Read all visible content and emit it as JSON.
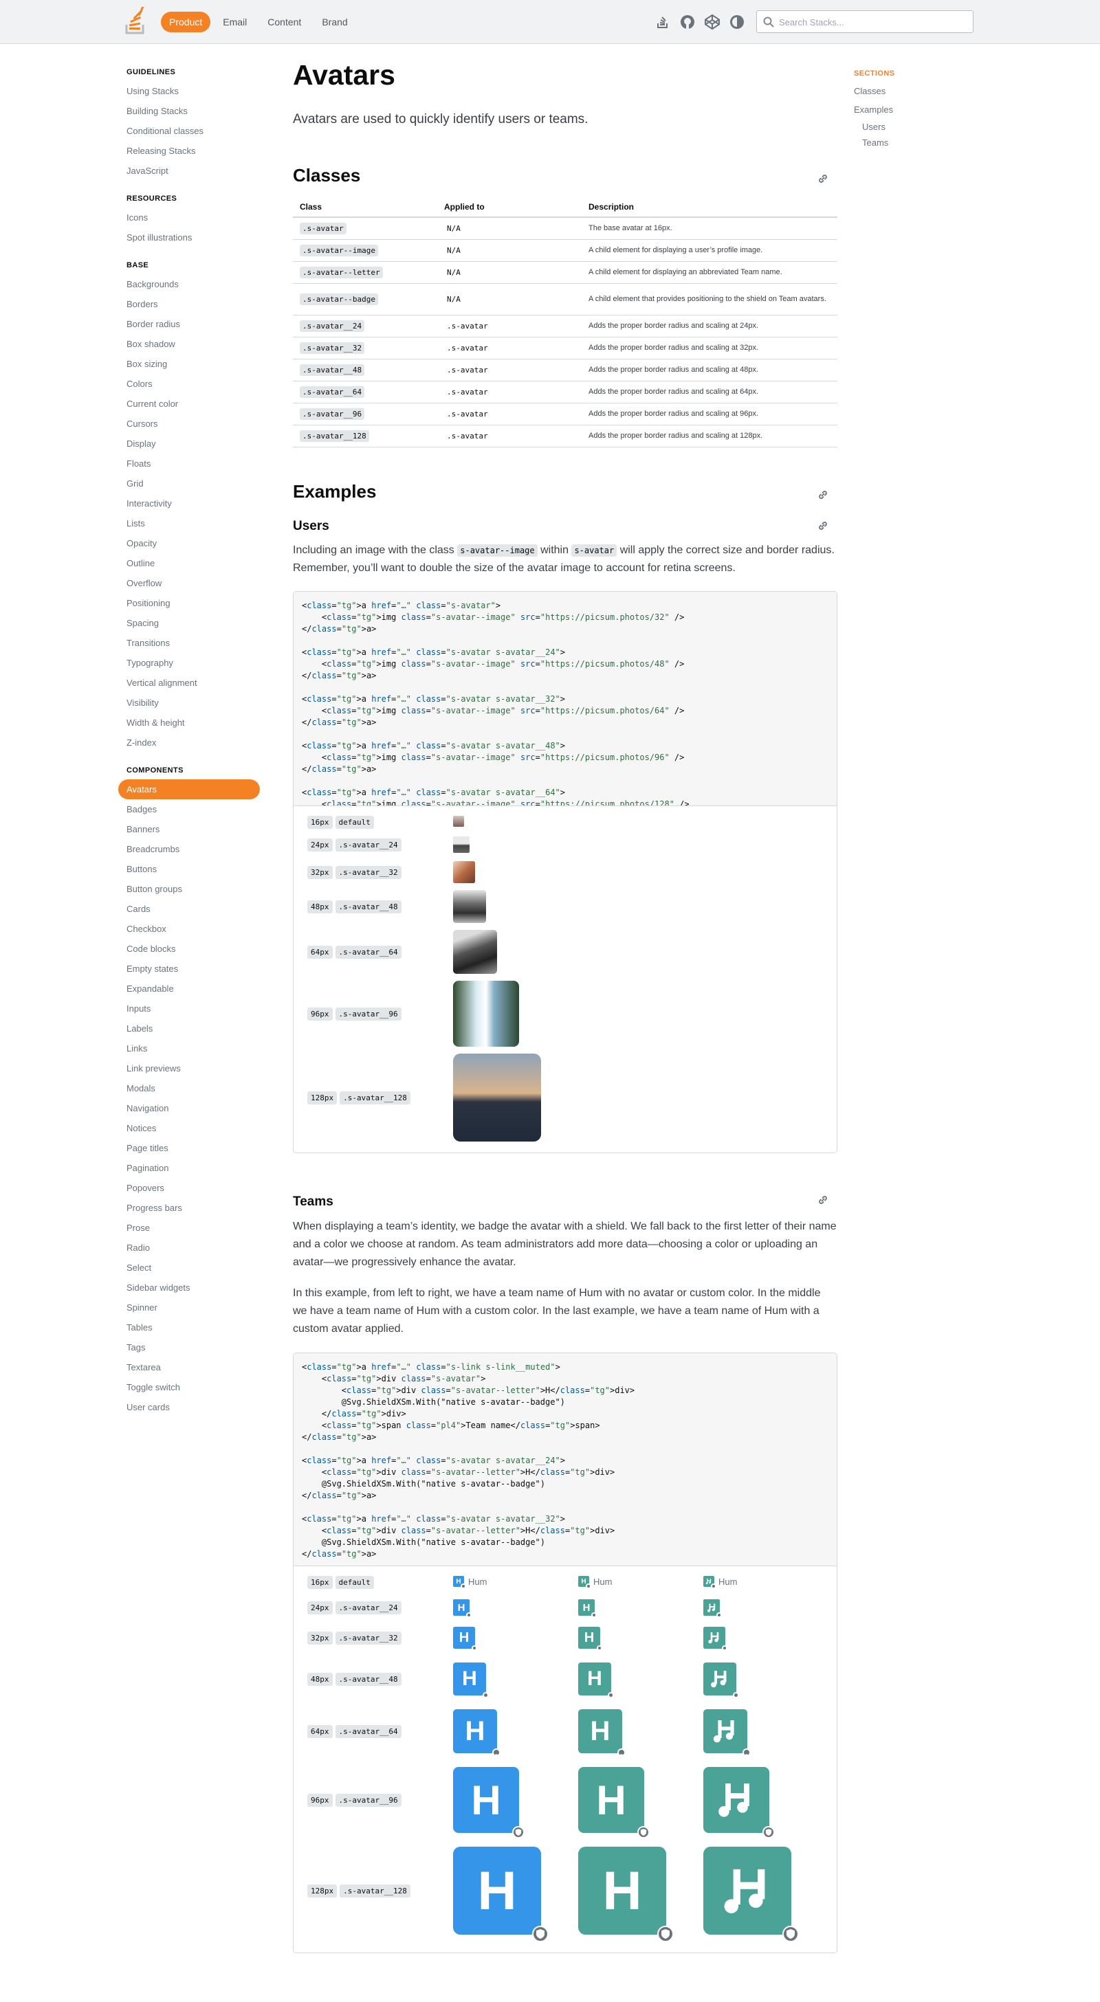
{
  "topbar": {
    "nav": [
      "Product",
      "Email",
      "Content",
      "Brand"
    ],
    "search_placeholder": "Search Stacks...",
    "icons": [
      "stack-overflow-icon",
      "github-icon",
      "codepen-icon",
      "theme-toggle-icon"
    ]
  },
  "sidebar": {
    "guidelines_title": "GUIDELINES",
    "guidelines": [
      "Using Stacks",
      "Building Stacks",
      "Conditional classes",
      "Releasing Stacks",
      "JavaScript"
    ],
    "resources_title": "RESOURCES",
    "resources": [
      "Icons",
      "Spot illustrations"
    ],
    "base_title": "BASE",
    "base": [
      "Backgrounds",
      "Borders",
      "Border radius",
      "Box shadow",
      "Box sizing",
      "Colors",
      "Current color",
      "Cursors",
      "Display",
      "Floats",
      "Grid",
      "Interactivity",
      "Lists",
      "Opacity",
      "Outline",
      "Overflow",
      "Positioning",
      "Spacing",
      "Transitions",
      "Typography",
      "Vertical alignment",
      "Visibility",
      "Width & height",
      "Z-index"
    ],
    "components_title": "COMPONENTS",
    "components": [
      "Avatars",
      "Badges",
      "Banners",
      "Breadcrumbs",
      "Buttons",
      "Button groups",
      "Cards",
      "Checkbox",
      "Code blocks",
      "Empty states",
      "Expandable",
      "Inputs",
      "Labels",
      "Links",
      "Link previews",
      "Modals",
      "Navigation",
      "Notices",
      "Page titles",
      "Pagination",
      "Popovers",
      "Progress bars",
      "Prose",
      "Radio",
      "Select",
      "Sidebar widgets",
      "Spinner",
      "Tables",
      "Tags",
      "Textarea",
      "Toggle switch",
      "User cards"
    ],
    "active": "Avatars"
  },
  "toc": {
    "title": "SECTIONS",
    "items": [
      "Classes",
      "Examples"
    ],
    "sub": [
      "Users",
      "Teams"
    ]
  },
  "page": {
    "title": "Avatars",
    "lead": "Avatars are used to quickly identify users or teams."
  },
  "classes": {
    "title": "Classes",
    "headers": [
      "Class",
      "Applied to",
      "Description"
    ],
    "rows": [
      [
        ".s-avatar",
        "N/A",
        "The base avatar at 16px."
      ],
      [
        ".s-avatar--image",
        "N/A",
        "A child element for displaying a user’s profile image."
      ],
      [
        ".s-avatar--letter",
        "N/A",
        "A child element for displaying an abbreviated Team name."
      ],
      [
        ".s-avatar--badge",
        "N/A",
        "A child element that provides positioning to the shield on Team avatars."
      ],
      [
        ".s-avatar__24",
        ".s-avatar",
        "Adds the proper border radius and scaling at 24px."
      ],
      [
        ".s-avatar__32",
        ".s-avatar",
        "Adds the proper border radius and scaling at 32px."
      ],
      [
        ".s-avatar__48",
        ".s-avatar",
        "Adds the proper border radius and scaling at 48px."
      ],
      [
        ".s-avatar__64",
        ".s-avatar",
        "Adds the proper border radius and scaling at 64px."
      ],
      [
        ".s-avatar__96",
        ".s-avatar",
        "Adds the proper border radius and scaling at 96px."
      ],
      [
        ".s-avatar__128",
        ".s-avatar",
        "Adds the proper border radius and scaling at 128px."
      ]
    ]
  },
  "examples": {
    "title": "Examples",
    "users": {
      "title": "Users",
      "para_1": "Including an image with the class",
      "code_1": "s-avatar--image",
      "para_2": "within",
      "code_2": "s-avatar",
      "para_3": "will apply the correct size and border radius. Remember, you’ll want to double the size of the avatar image to account for retina screens.",
      "code": "<a href=\"…\" class=\"s-avatar\">\n    <img class=\"s-avatar--image\" src=\"https://picsum.photos/32\" />\n</a>\n\n<a href=\"…\" class=\"s-avatar s-avatar__24\">\n    <img class=\"s-avatar--image\" src=\"https://picsum.photos/48\" />\n</a>\n\n<a href=\"…\" class=\"s-avatar s-avatar__32\">\n    <img class=\"s-avatar--image\" src=\"https://picsum.photos/64\" />\n</a>\n\n<a href=\"…\" class=\"s-avatar s-avatar__48\">\n    <img class=\"s-avatar--image\" src=\"https://picsum.photos/96\" />\n</a>\n\n<a href=\"…\" class=\"s-avatar s-avatar__64\">\n    <img class=\"s-avatar--image\" src=\"https://picsum.photos/128\" />",
      "rows": [
        {
          "size": "16px",
          "cls": "default"
        },
        {
          "size": "24px",
          "cls": ".s-avatar__24"
        },
        {
          "size": "32px",
          "cls": ".s-avatar__32"
        },
        {
          "size": "48px",
          "cls": ".s-avatar__48"
        },
        {
          "size": "64px",
          "cls": ".s-avatar__64"
        },
        {
          "size": "96px",
          "cls": ".s-avatar__96"
        },
        {
          "size": "128px",
          "cls": ".s-avatar__128"
        }
      ]
    },
    "teams": {
      "title": "Teams",
      "para_a": "When displaying a team’s identity, we badge the avatar with a shield. We fall back to the first letter of their name and a color we choose at random. As team administrators add more data—choosing a color or uploading an avatar—we progressively enhance the avatar.",
      "para_b": "In this example, from left to right, we have a team name of Hum with no avatar or custom color. In the middle we have a team name of Hum with a custom color. In the last example, we have a team name of Hum with a custom avatar applied.",
      "code": "<a href=\"…\" class=\"s-link s-link__muted\">\n    <div class=\"s-avatar\">\n        <div class=\"s-avatar--letter\">H</div>\n        @Svg.ShieldXSm.With(\"native s-avatar--badge\")\n    </div>\n    <span class=\"pl4\">Team name</span>\n</a>\n\n<a href=\"…\" class=\"s-avatar s-avatar__24\">\n    <div class=\"s-avatar--letter\">H</div>\n    @Svg.ShieldXSm.With(\"native s-avatar--badge\")\n</a>\n\n<a href=\"…\" class=\"s-avatar s-avatar__32\">\n    <div class=\"s-avatar--letter\">H</div>\n    @Svg.ShieldXSm.With(\"native s-avatar--badge\")\n</a>",
      "team_name": "Hum",
      "letter": "H",
      "colors": [
        "#3595e9",
        "#4aa396",
        "#4aa396"
      ],
      "rows": [
        {
          "size": "16px",
          "cls": "default"
        },
        {
          "size": "24px",
          "cls": ".s-avatar__24"
        },
        {
          "size": "32px",
          "cls": ".s-avatar__32"
        },
        {
          "size": "48px",
          "cls": ".s-avatar__48"
        },
        {
          "size": "64px",
          "cls": ".s-avatar__64"
        },
        {
          "size": "96px",
          "cls": ".s-avatar__96"
        },
        {
          "size": "128px",
          "cls": ".s-avatar__128"
        }
      ]
    }
  },
  "colors": {
    "accent": "#f48225",
    "link": "#6a737c",
    "code_bg": "#f6f6f6"
  }
}
